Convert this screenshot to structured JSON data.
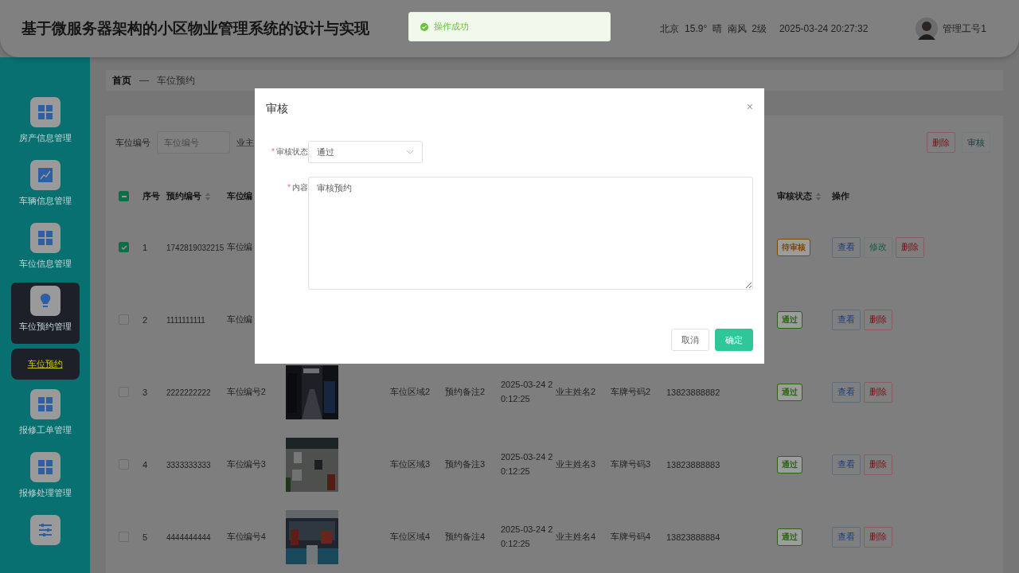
{
  "header": {
    "title": "基于微服务器架构的小区物业管理系统的设计与实现",
    "weather": "北京  15.9°  晴  南风  2级",
    "datetime": "2025-03-24 20:27:32",
    "user": "管理工号1"
  },
  "toast": {
    "kind": "success",
    "message": "操作成功"
  },
  "sidebar": {
    "items": [
      {
        "label": "房产信息管理",
        "selected": false
      },
      {
        "label": "车辆信息管理",
        "selected": false
      },
      {
        "label": "车位信息管理",
        "selected": false
      },
      {
        "label": "车位预约管理",
        "selected": true,
        "children": [
          {
            "label": "车位预约",
            "selected": true
          }
        ]
      },
      {
        "label": "报修工单管理",
        "selected": false
      },
      {
        "label": "报修处理管理",
        "selected": false
      },
      {
        "selected": false
      }
    ]
  },
  "breadcrumb": {
    "home": "首页",
    "separator": "—",
    "current": "车位预约"
  },
  "filters": [
    {
      "label": "车位编号",
      "placeholder": "车位编号"
    },
    {
      "label": "业主"
    }
  ],
  "toolbar": [
    {
      "kind": "delete",
      "label": "删除"
    },
    {
      "kind": "audit",
      "label": "审核"
    }
  ],
  "table": {
    "select_all": {
      "checked": true,
      "indeterminate": true
    },
    "columns": [
      {
        "label": "序号",
        "sortable": false
      },
      {
        "label": "预约编号",
        "sortable": true
      },
      {
        "label": "车位编",
        "sortable": false
      },
      {
        "label": "审核状态",
        "sortable": true
      },
      {
        "label": "操作",
        "sortable": false
      }
    ],
    "rows": [
      {
        "checked": true,
        "index": "1",
        "booking_no": "1742819032215",
        "space_no": "车位编",
        "status": {
          "text": "待审核",
          "color": "#7a4a00"
        },
        "actions": [
          {
            "kind": "view",
            "label": "查看"
          },
          {
            "kind": "edit",
            "label": "修改"
          },
          {
            "kind": "delete",
            "label": "删除"
          }
        ]
      },
      {
        "checked": false,
        "index": "2",
        "booking_no": "1111111111",
        "space_no": "车位编",
        "status": {
          "text": "通过",
          "color": "#2a6410"
        },
        "actions": [
          {
            "kind": "view",
            "label": "查看"
          },
          {
            "kind": "delete",
            "label": "删除"
          }
        ]
      },
      {
        "checked": false,
        "index": "3",
        "booking_no": "2222222222",
        "space_no": "车位编号2",
        "picture": {
          "kind": "picture"
        },
        "area": "车位区域2",
        "remark": "预约备注2",
        "time": "2025-03-24 20:12:25",
        "owner": "业主姓名2",
        "plate": "车牌号码2",
        "phone": "13823888882",
        "status": {
          "text": "通过",
          "color": "#2a6410"
        },
        "actions": [
          {
            "kind": "view",
            "label": "查看"
          },
          {
            "kind": "delete",
            "label": "删除"
          }
        ]
      },
      {
        "checked": false,
        "index": "4",
        "booking_no": "3333333333",
        "space_no": "车位编号3",
        "picture": {
          "kind": "picture"
        },
        "area": "车位区域3",
        "remark": "预约备注3",
        "time": "2025-03-24 20:12:25",
        "owner": "业主姓名3",
        "plate": "车牌号码3",
        "phone": "13823888883",
        "status": {
          "text": "通过",
          "color": "#2a6410"
        },
        "actions": [
          {
            "kind": "view",
            "label": "查看"
          },
          {
            "kind": "delete",
            "label": "删除"
          }
        ]
      },
      {
        "checked": false,
        "index": "5",
        "booking_no": "4444444444",
        "space_no": "车位编号4",
        "picture": {
          "kind": "picture"
        },
        "area": "车位区域4",
        "remark": "预约备注4",
        "time": "2025-03-24 20:12:25",
        "owner": "业主姓名4",
        "plate": "车牌号码4",
        "phone": "13823888884",
        "status": {
          "text": "通过",
          "color": "#2a6410"
        },
        "actions": [
          {
            "kind": "view",
            "label": "查看"
          },
          {
            "kind": "delete",
            "label": "删除"
          }
        ]
      }
    ]
  },
  "dialog": {
    "title": "审核",
    "close": "×",
    "fields": [
      {
        "kind": "select",
        "required": true,
        "required_mark": "*",
        "label": "审核状态",
        "value": "通过"
      },
      {
        "kind": "textarea",
        "required": true,
        "required_mark": "*",
        "label": "内容",
        "value": "审核预约"
      }
    ],
    "buttons": [
      {
        "kind": "cancel",
        "label": "取消"
      },
      {
        "kind": "confirm",
        "label": "确定"
      }
    ]
  }
}
